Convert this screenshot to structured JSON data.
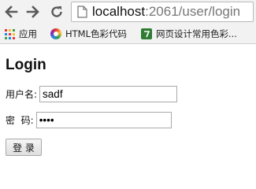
{
  "browser": {
    "url_host": "localhost",
    "url_rest": ":2061/user/login",
    "icons": {
      "back": "back-arrow-icon",
      "forward": "forward-arrow-icon",
      "reload": "reload-icon",
      "page": "page-icon"
    }
  },
  "bookmarks": [
    {
      "label": "应用",
      "icon": "apps-grid-icon"
    },
    {
      "label": "HTML色彩代码",
      "icon": "color-wheel-icon"
    },
    {
      "label": "网页设计常用色彩...",
      "icon": "web-color-icon"
    }
  ],
  "page": {
    "title": "Login",
    "username_label": "用户名:",
    "username_value": "sadf",
    "password_label": "密  码:",
    "password_value": "••••",
    "submit_label": "登 录"
  },
  "colors": {
    "toolbar_bg": "#f2f2f2",
    "page_bg": "#ffffff"
  }
}
